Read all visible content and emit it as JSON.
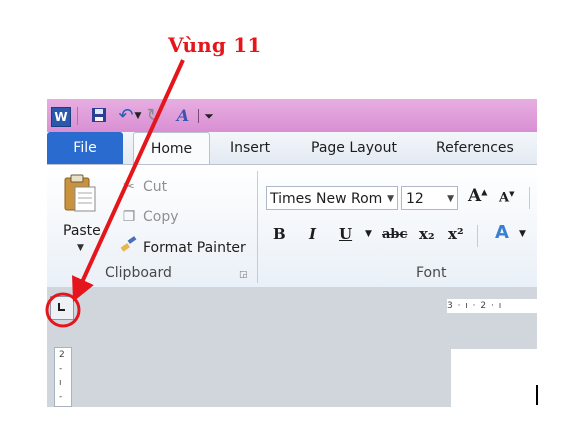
{
  "annotation": {
    "label": "Vùng 11",
    "color": "#e4161b"
  },
  "quick_access": {
    "icons": [
      "word-icon",
      "save-icon",
      "undo-icon",
      "redo-icon",
      "format-icon"
    ],
    "word_letter": "W",
    "more": "⏷"
  },
  "tabs": {
    "file": "File",
    "home": "Home",
    "insert": "Insert",
    "page_layout": "Page Layout",
    "references": "References"
  },
  "clipboard": {
    "paste": "Paste",
    "cut": "Cut",
    "copy": "Copy",
    "format_painter": "Format Painter",
    "group_label": "Clipboard"
  },
  "font": {
    "font_name": "Times New Rom",
    "font_size": "12",
    "bold": "B",
    "italic": "I",
    "underline": "U",
    "strikethrough": "abc",
    "subscript": "x₂",
    "superscript": "x²",
    "grow": "A",
    "shrink": "A",
    "effects": "A",
    "group_label": "Font"
  },
  "ruler": {
    "horizontal": "3 · ı · 2 · ı",
    "vertical": [
      "2",
      "-",
      "ı",
      "-"
    ]
  }
}
